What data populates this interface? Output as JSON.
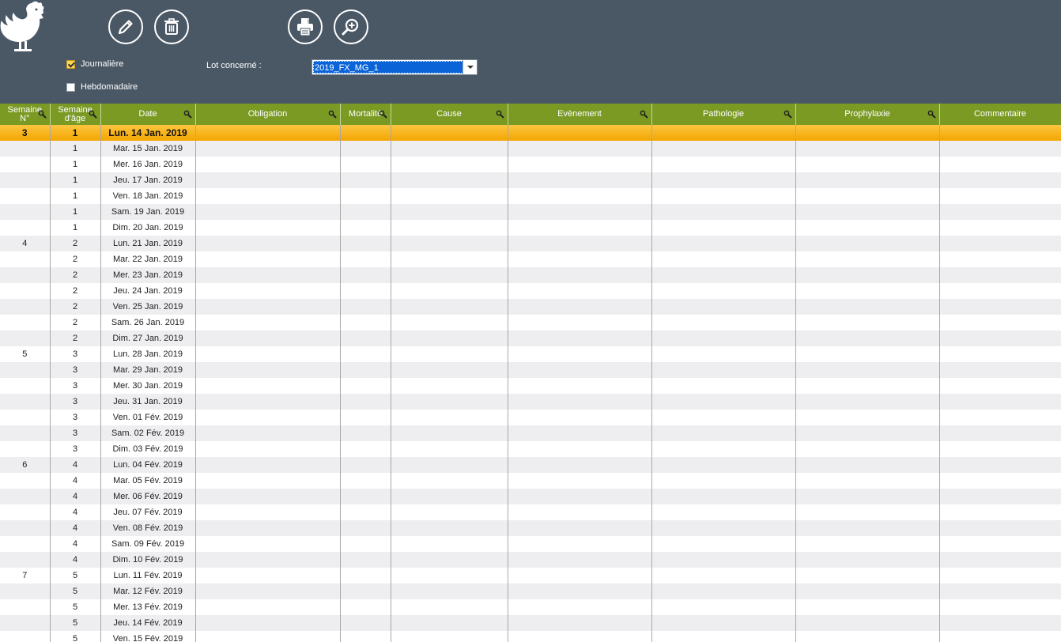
{
  "toolbar": {
    "journaliere_label": "Journalière",
    "journaliere_checked": true,
    "hebdomadaire_label": "Hebdomadaire",
    "hebdomadaire_checked": false,
    "lot_label": "Lot concerné :",
    "lot_value": "2019_FX_MG_1"
  },
  "icons": {
    "logo": "chicken-logo-icon",
    "edit": "pencil-icon",
    "delete": "trash-icon",
    "print": "printer-icon",
    "zoom": "zoom-in-icon",
    "sort": "search-filter-icon"
  },
  "colors": {
    "topbar": "#4a5866",
    "header": "#7a9a24",
    "selected_row": "#f8a800",
    "alt_row": "#eeedf0"
  },
  "columns": [
    {
      "label": "Semaine\nN°",
      "filter": true
    },
    {
      "label": "Semaine\nd'âge",
      "filter": true
    },
    {
      "label": "Date",
      "filter": true
    },
    {
      "label": "Obligation",
      "filter": true
    },
    {
      "label": "Mortalité",
      "filter": true
    },
    {
      "label": "Cause",
      "filter": true
    },
    {
      "label": "Evènement",
      "filter": true
    },
    {
      "label": "Pathologie",
      "filter": true
    },
    {
      "label": "Prophylaxie",
      "filter": true
    },
    {
      "label": "Commentaire",
      "filter": false
    }
  ],
  "selected_row_index": 0,
  "rows": [
    [
      "3",
      "1",
      "Lun. 14 Jan. 2019",
      "",
      "",
      "",
      "",
      "",
      "",
      ""
    ],
    [
      "",
      "1",
      "Mar. 15 Jan. 2019",
      "",
      "",
      "",
      "",
      "",
      "",
      ""
    ],
    [
      "",
      "1",
      "Mer. 16 Jan. 2019",
      "",
      "",
      "",
      "",
      "",
      "",
      ""
    ],
    [
      "",
      "1",
      "Jeu. 17 Jan. 2019",
      "",
      "",
      "",
      "",
      "",
      "",
      ""
    ],
    [
      "",
      "1",
      "Ven. 18 Jan. 2019",
      "",
      "",
      "",
      "",
      "",
      "",
      ""
    ],
    [
      "",
      "1",
      "Sam. 19 Jan. 2019",
      "",
      "",
      "",
      "",
      "",
      "",
      ""
    ],
    [
      "",
      "1",
      "Dim. 20 Jan. 2019",
      "",
      "",
      "",
      "",
      "",
      "",
      ""
    ],
    [
      "4",
      "2",
      "Lun. 21 Jan. 2019",
      "",
      "",
      "",
      "",
      "",
      "",
      ""
    ],
    [
      "",
      "2",
      "Mar. 22 Jan. 2019",
      "",
      "",
      "",
      "",
      "",
      "",
      ""
    ],
    [
      "",
      "2",
      "Mer. 23 Jan. 2019",
      "",
      "",
      "",
      "",
      "",
      "",
      ""
    ],
    [
      "",
      "2",
      "Jeu. 24 Jan. 2019",
      "",
      "",
      "",
      "",
      "",
      "",
      ""
    ],
    [
      "",
      "2",
      "Ven. 25 Jan. 2019",
      "",
      "",
      "",
      "",
      "",
      "",
      ""
    ],
    [
      "",
      "2",
      "Sam. 26 Jan. 2019",
      "",
      "",
      "",
      "",
      "",
      "",
      ""
    ],
    [
      "",
      "2",
      "Dim. 27 Jan. 2019",
      "",
      "",
      "",
      "",
      "",
      "",
      ""
    ],
    [
      "5",
      "3",
      "Lun. 28 Jan. 2019",
      "",
      "",
      "",
      "",
      "",
      "",
      ""
    ],
    [
      "",
      "3",
      "Mar. 29 Jan. 2019",
      "",
      "",
      "",
      "",
      "",
      "",
      ""
    ],
    [
      "",
      "3",
      "Mer. 30 Jan. 2019",
      "",
      "",
      "",
      "",
      "",
      "",
      ""
    ],
    [
      "",
      "3",
      "Jeu. 31 Jan. 2019",
      "",
      "",
      "",
      "",
      "",
      "",
      ""
    ],
    [
      "",
      "3",
      "Ven. 01 Fév. 2019",
      "",
      "",
      "",
      "",
      "",
      "",
      ""
    ],
    [
      "",
      "3",
      "Sam. 02 Fév. 2019",
      "",
      "",
      "",
      "",
      "",
      "",
      ""
    ],
    [
      "",
      "3",
      "Dim. 03 Fév. 2019",
      "",
      "",
      "",
      "",
      "",
      "",
      ""
    ],
    [
      "6",
      "4",
      "Lun. 04 Fév. 2019",
      "",
      "",
      "",
      "",
      "",
      "",
      ""
    ],
    [
      "",
      "4",
      "Mar. 05 Fév. 2019",
      "",
      "",
      "",
      "",
      "",
      "",
      ""
    ],
    [
      "",
      "4",
      "Mer. 06 Fév. 2019",
      "",
      "",
      "",
      "",
      "",
      "",
      ""
    ],
    [
      "",
      "4",
      "Jeu. 07 Fév. 2019",
      "",
      "",
      "",
      "",
      "",
      "",
      ""
    ],
    [
      "",
      "4",
      "Ven. 08 Fév. 2019",
      "",
      "",
      "",
      "",
      "",
      "",
      ""
    ],
    [
      "",
      "4",
      "Sam. 09 Fév. 2019",
      "",
      "",
      "",
      "",
      "",
      "",
      ""
    ],
    [
      "",
      "4",
      "Dim. 10 Fév. 2019",
      "",
      "",
      "",
      "",
      "",
      "",
      ""
    ],
    [
      "7",
      "5",
      "Lun. 11 Fév. 2019",
      "",
      "",
      "",
      "",
      "",
      "",
      ""
    ],
    [
      "",
      "5",
      "Mar. 12 Fév. 2019",
      "",
      "",
      "",
      "",
      "",
      "",
      ""
    ],
    [
      "",
      "5",
      "Mer. 13 Fév. 2019",
      "",
      "",
      "",
      "",
      "",
      "",
      ""
    ],
    [
      "",
      "5",
      "Jeu. 14 Fév. 2019",
      "",
      "",
      "",
      "",
      "",
      "",
      ""
    ],
    [
      "",
      "5",
      "Ven. 15 Fév. 2019",
      "",
      "",
      "",
      "",
      "",
      "",
      ""
    ]
  ]
}
